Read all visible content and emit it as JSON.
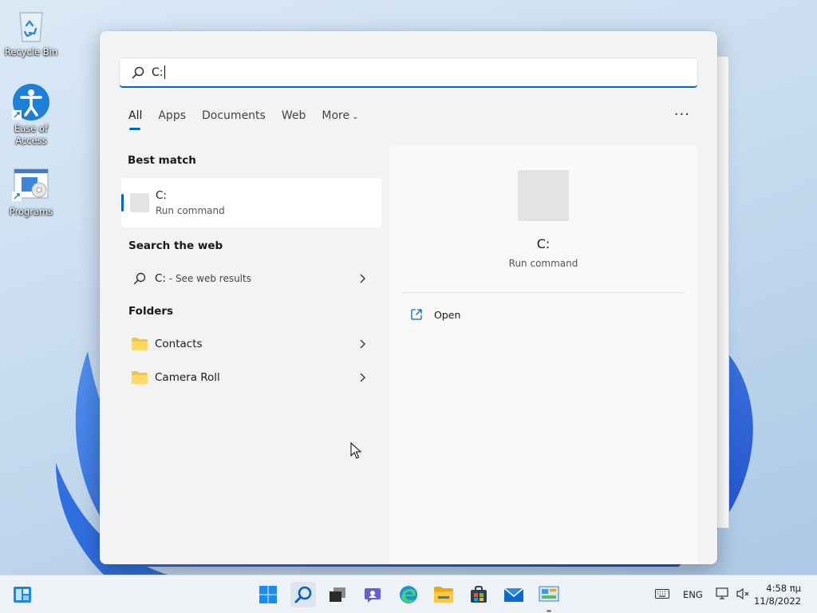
{
  "desktop": {
    "icons": [
      {
        "label": "Recycle Bin",
        "icon": "recycle-bin-icon"
      },
      {
        "label": "Ease of Access",
        "icon": "accessibility-icon"
      },
      {
        "label": "Programs",
        "icon": "programs-icon"
      }
    ]
  },
  "search": {
    "query": "C:",
    "tabs": [
      {
        "label": "All",
        "active": true
      },
      {
        "label": "Apps"
      },
      {
        "label": "Documents"
      },
      {
        "label": "Web"
      },
      {
        "label": "More"
      }
    ],
    "more_options_label": "···",
    "best_match": {
      "section_title": "Best match",
      "title": "C:",
      "subtitle": "Run command"
    },
    "web": {
      "section_title": "Search the web",
      "query": "C:",
      "suffix": " - See web results"
    },
    "folders": {
      "section_title": "Folders",
      "items": [
        {
          "label": "Contacts"
        },
        {
          "label": "Camera Roll"
        }
      ]
    },
    "preview": {
      "title": "C:",
      "subtitle": "Run command",
      "action_label": "Open"
    }
  },
  "taskbar": {
    "language": "ENG",
    "time": "4:58 πμ",
    "date": "11/8/2022",
    "icons": [
      "widgets-icon",
      "start-icon",
      "search-icon",
      "task-view-icon",
      "chat-icon",
      "edge-icon",
      "file-explorer-icon",
      "store-icon",
      "mail-icon",
      "control-panel-icon"
    ]
  },
  "colors": {
    "accent": "#0067c0",
    "panel_bg": "#f3f3f3",
    "folder": "#f4c542"
  }
}
